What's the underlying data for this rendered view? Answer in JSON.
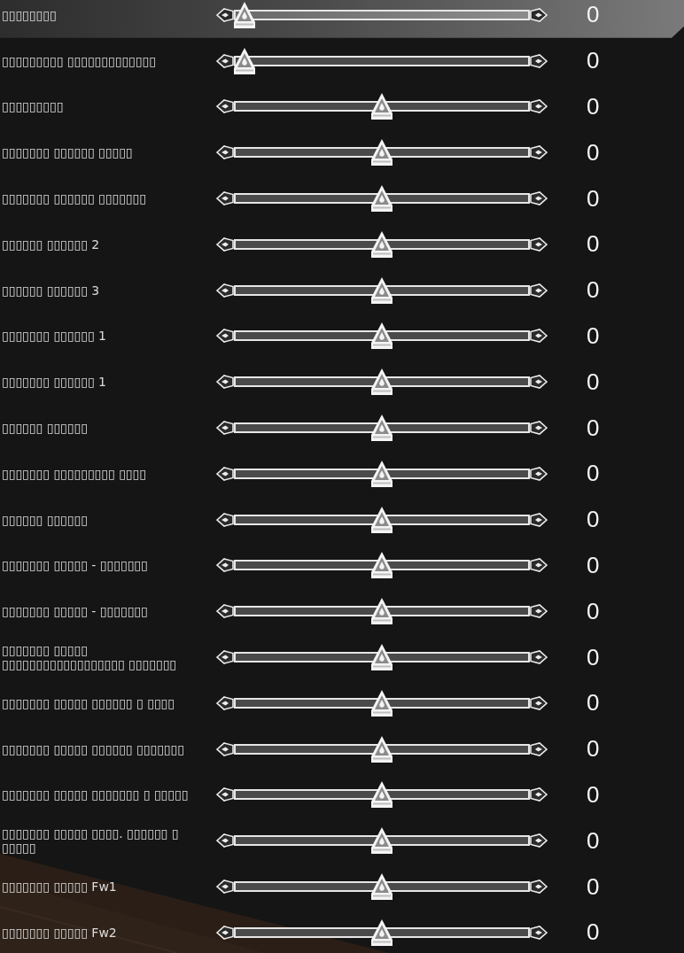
{
  "settings": [
    {
      "label": "▯▯▯▯▯▯▯▯",
      "selected": true,
      "level": 0,
      "value": "0"
    },
    {
      "label": "▯▯▯▯▯▯▯▯▯ ▯▯▯▯▯▯▯▯▯▯▯▯▯",
      "selected": false,
      "level": 0,
      "value": "0"
    },
    {
      "label": "▯▯▯▯▯▯▯▯▯",
      "selected": false,
      "level": 0.5,
      "value": "0"
    },
    {
      "label": "▯▯▯▯▯▯▯ ▯▯▯▯▯▯ ▯▯▯▯▯",
      "selected": false,
      "level": 0.5,
      "value": "0"
    },
    {
      "label": "▯▯▯▯▯▯▯ ▯▯▯▯▯▯ ▯▯▯▯▯▯▯",
      "selected": false,
      "level": 0.5,
      "value": "0"
    },
    {
      "label": "▯▯▯▯▯▯ ▯▯▯▯▯▯ 2",
      "selected": false,
      "level": 0.5,
      "value": "0"
    },
    {
      "label": "▯▯▯▯▯▯ ▯▯▯▯▯▯ 3",
      "selected": false,
      "level": 0.5,
      "value": "0"
    },
    {
      "label": "▯▯▯▯▯▯▯ ▯▯▯▯▯▯ 1",
      "selected": false,
      "level": 0.5,
      "value": "0"
    },
    {
      "label": "▯▯▯▯▯▯▯ ▯▯▯▯▯▯ 1",
      "selected": false,
      "level": 0.5,
      "value": "0"
    },
    {
      "label": "▯▯▯▯▯▯ ▯▯▯▯▯▯",
      "selected": false,
      "level": 0.5,
      "value": "0"
    },
    {
      "label": "▯▯▯▯▯▯▯ ▯▯▯▯▯▯▯▯▯ ▯▯▯▯",
      "selected": false,
      "level": 0.5,
      "value": "0"
    },
    {
      "label": "▯▯▯▯▯▯ ▯▯▯▯▯▯",
      "selected": false,
      "level": 0.5,
      "value": "0"
    },
    {
      "label": "▯▯▯▯▯▯▯ ▯▯▯▯▯ - ▯▯▯▯▯▯▯",
      "selected": false,
      "level": 0.5,
      "value": "0"
    },
    {
      "label": "▯▯▯▯▯▯▯ ▯▯▯▯▯ - ▯▯▯▯▯▯▯",
      "selected": false,
      "level": 0.5,
      "value": "0"
    },
    {
      "label": "▯▯▯▯▯▯▯ ▯▯▯▯▯ ▯▯▯▯▯▯▯▯▯▯▯▯▯▯▯▯▯▯ ▯▯▯▯▯▯▯",
      "selected": false,
      "level": 0.5,
      "value": "0"
    },
    {
      "label": "▯▯▯▯▯▯▯ ▯▯▯▯▯ ▯▯▯▯▯▯ ▯ ▯▯▯▯",
      "selected": false,
      "level": 0.5,
      "value": "0"
    },
    {
      "label": "▯▯▯▯▯▯▯ ▯▯▯▯▯ ▯▯▯▯▯▯ ▯▯▯▯▯▯▯",
      "selected": false,
      "level": 0.5,
      "value": "0"
    },
    {
      "label": "▯▯▯▯▯▯▯ ▯▯▯▯▯ ▯▯▯▯▯▯▯ ▯ ▯▯▯▯▯",
      "selected": false,
      "level": 0.5,
      "value": "0"
    },
    {
      "label": "▯▯▯▯▯▯▯ ▯▯▯▯▯ ▯▯▯▯. ▯▯▯▯▯▯ ▯ ▯▯▯▯▯",
      "selected": false,
      "level": 0.5,
      "value": "0"
    },
    {
      "label": "▯▯▯▯▯▯▯ ▯▯▯▯▯ Fw1",
      "selected": false,
      "level": 0.5,
      "value": "0"
    },
    {
      "label": "▯▯▯▯▯▯▯ ▯▯▯▯▯ Fw2",
      "selected": false,
      "level": 0.5,
      "value": "0"
    }
  ]
}
